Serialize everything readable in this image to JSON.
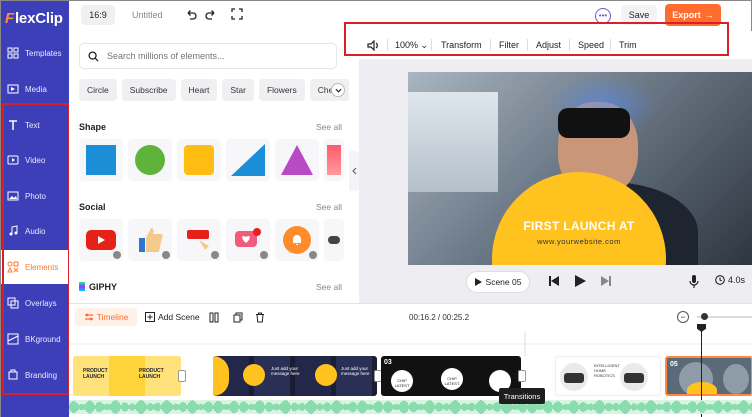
{
  "app": {
    "logo_rest": "lexClip",
    "logo_letter": "F",
    "ratio": "16:9",
    "title": "Untitled",
    "save_label": "Save",
    "export_label": "Export",
    "accent": "#ff6d2e",
    "sidebar_color": "#3d3fb8"
  },
  "sidebar": {
    "items": [
      {
        "label": "Templates",
        "icon": "templates-icon"
      },
      {
        "label": "Media",
        "icon": "media-icon"
      },
      {
        "label": "Text",
        "icon": "text-icon"
      },
      {
        "label": "Video",
        "icon": "video-icon"
      },
      {
        "label": "Photo",
        "icon": "photo-icon"
      },
      {
        "label": "Audio",
        "icon": "audio-icon"
      },
      {
        "label": "Elements",
        "icon": "elements-icon",
        "active": true
      },
      {
        "label": "Overlays",
        "icon": "overlays-icon"
      },
      {
        "label": "BKground",
        "icon": "background-icon"
      },
      {
        "label": "Branding",
        "icon": "branding-icon"
      }
    ]
  },
  "panel": {
    "search_placeholder": "Search millions of elements...",
    "chips": [
      "Circle",
      "Subscribe",
      "Heart",
      "Star",
      "Flowers",
      "Check"
    ],
    "sections": [
      {
        "title": "Shape",
        "see_all": "See all"
      },
      {
        "title": "Social",
        "see_all": "See all"
      },
      {
        "title": "GIPHY",
        "see_all": "See all"
      }
    ]
  },
  "toolbar": {
    "zoom": "100%",
    "items": [
      "Transform",
      "Filter",
      "Adjust",
      "Speed",
      "Trim"
    ]
  },
  "preview": {
    "headline": "FIRST LAUNCH AT",
    "url": "www.yourwebsite.com",
    "scene_label": "Scene 05",
    "duration": "4.0s"
  },
  "timeline": {
    "tab_label": "Timeline",
    "add_scene_label": "Add Scene",
    "time": "00:16.2 / 00:25.2",
    "tooltip": "Transitions",
    "clips": [
      {
        "label": "",
        "thumb_text": "PRODUCT LAUNCH"
      },
      {
        "label": "",
        "thumb_text": "Just add your message here"
      },
      {
        "label": "03",
        "thumb_text": "CHIP LATEST"
      },
      {
        "label": "",
        "thumb_text": "INTELLIGENT HOME ROBOTICS"
      },
      {
        "label": "05",
        "thumb_text": ""
      }
    ]
  }
}
